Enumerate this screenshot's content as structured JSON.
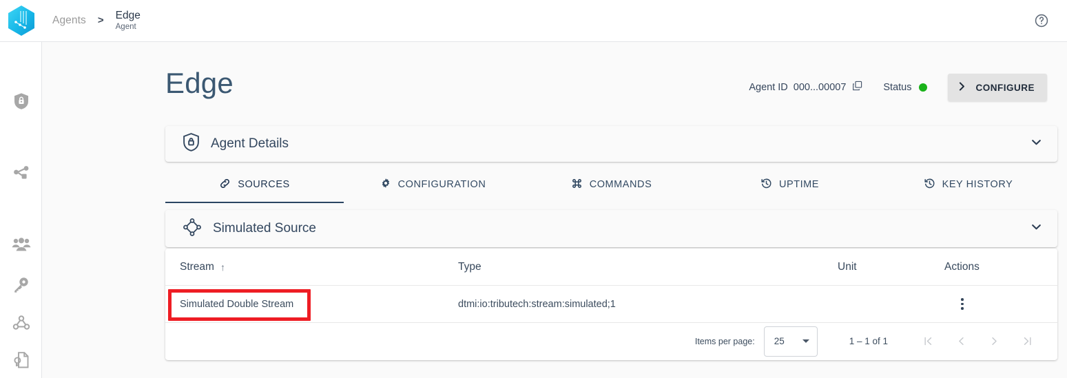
{
  "topbar": {
    "logo_name": "tributech-hex-logo",
    "breadcrumb": {
      "root": "Agents",
      "separator": ">",
      "current": "Edge",
      "current_sub": "Agent"
    },
    "help_icon": "help-circle-icon"
  },
  "sidebar": {
    "items": [
      {
        "icon": "shield-lock-icon",
        "name": "sidebar-item-shield-lock"
      },
      {
        "icon": "share-network-icon",
        "name": "sidebar-item-share-network"
      },
      {
        "icon": "people-group-icon",
        "name": "sidebar-item-people-group"
      },
      {
        "icon": "key-icon",
        "name": "sidebar-item-key"
      },
      {
        "icon": "webhook-icon",
        "name": "sidebar-item-webhook"
      },
      {
        "icon": "document-badge-icon",
        "name": "sidebar-item-document-badge"
      }
    ]
  },
  "page": {
    "title": "Edge",
    "agent_id_label": "Agent ID",
    "agent_id_value": "000...00007",
    "copy_icon": "copy-icon",
    "status_label": "Status",
    "status_color": "#19b219",
    "configure_label": "CONFIGURE",
    "configure_icon": "chevron-right-icon"
  },
  "panels": {
    "agent_details": {
      "title": "Agent Details",
      "icon": "shield-lock-icon",
      "expand_icon": "chevron-down-icon"
    },
    "simulated_source": {
      "title": "Simulated Source",
      "icon": "diamond-nodes-icon",
      "expand_icon": "chevron-down-icon"
    }
  },
  "tabs": [
    {
      "label": "SOURCES",
      "icon": "link-icon",
      "active": true
    },
    {
      "label": "CONFIGURATION",
      "icon": "gear-icon",
      "active": false
    },
    {
      "label": "COMMANDS",
      "icon": "command-icon",
      "active": false
    },
    {
      "label": "UPTIME",
      "icon": "history-icon",
      "active": false
    },
    {
      "label": "KEY HISTORY",
      "icon": "history-icon",
      "active": false
    }
  ],
  "table": {
    "columns": [
      "Stream",
      "Type",
      "Unit",
      "Actions"
    ],
    "sort_column": "Stream",
    "sort_direction": "↑",
    "rows": [
      {
        "stream": "Simulated Double Stream",
        "type": "dtmi:io:tributech:stream:simulated;1",
        "unit": "",
        "actions_icon": "more-vertical-icon"
      }
    ]
  },
  "paginator": {
    "items_per_page_label": "Items per page:",
    "items_per_page_value": "25",
    "range_label": "1 – 1 of 1",
    "buttons": [
      "first-page-icon",
      "previous-page-icon",
      "next-page-icon",
      "last-page-icon"
    ]
  },
  "annotation": {
    "highlight_color": "#ee1d24",
    "target": "Simulated Double Stream"
  }
}
